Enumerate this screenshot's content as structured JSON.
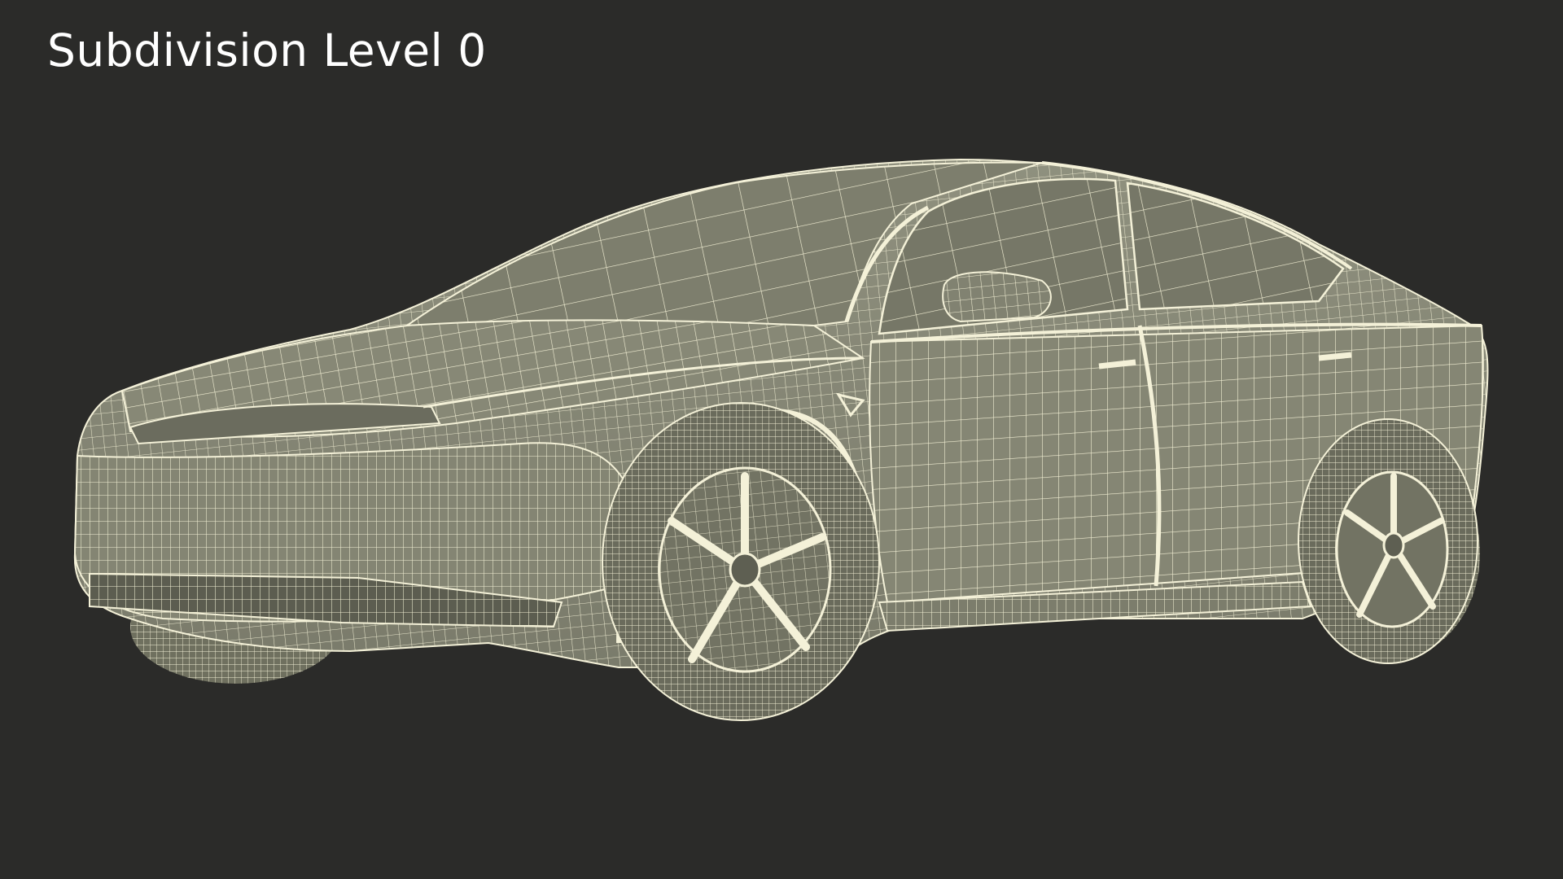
{
  "header": {
    "title": "Subdivision Level 0"
  },
  "render": {
    "subject": "car-wireframe",
    "colors": {
      "background": "#2b2b29",
      "surface": "#8a8b79",
      "surface_dark": "#6e6f60",
      "wire": "#f4f1d8",
      "title_text": "#ffffff"
    }
  }
}
